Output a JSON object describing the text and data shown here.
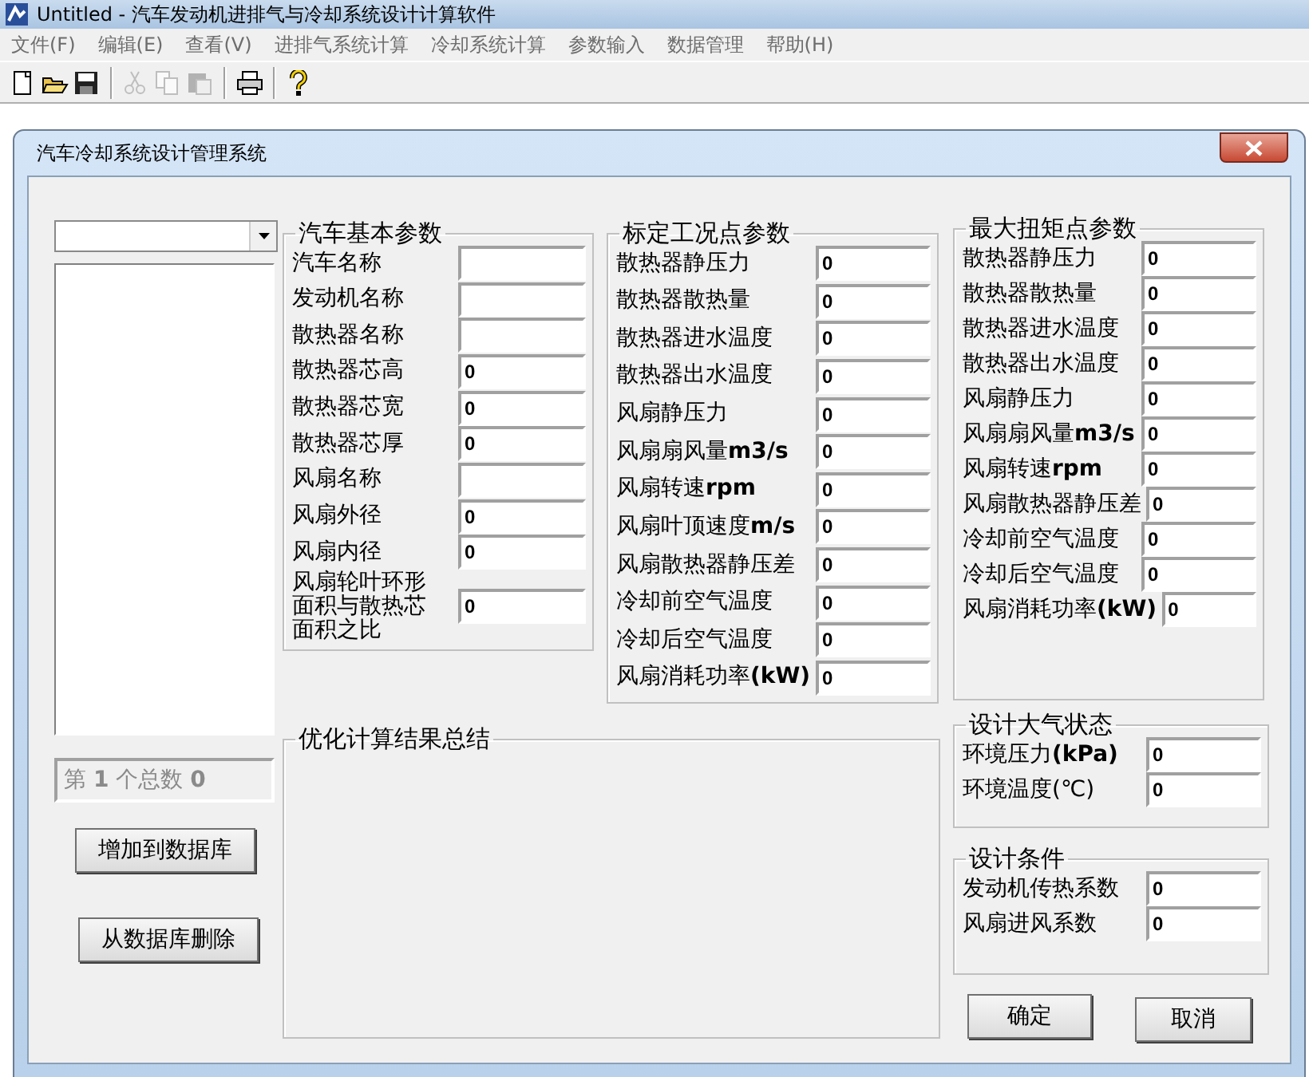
{
  "window": {
    "title": "Untitled - 汽车发动机进排气与冷却系统设计计算软件"
  },
  "menu": [
    "文件(F)",
    "编辑(E)",
    "查看(V)",
    "进排气系统计算",
    "冷却系统计算",
    "参数输入",
    "数据管理",
    "帮助(H)"
  ],
  "toolbar": [
    {
      "kind": "new",
      "disabled": false
    },
    {
      "kind": "open",
      "disabled": false
    },
    {
      "kind": "save",
      "disabled": false
    },
    {
      "kind": "separator"
    },
    {
      "kind": "cut",
      "disabled": true
    },
    {
      "kind": "copy",
      "disabled": true
    },
    {
      "kind": "paste",
      "disabled": true
    },
    {
      "kind": "separator"
    },
    {
      "kind": "print",
      "disabled": false
    },
    {
      "kind": "separator"
    },
    {
      "kind": "help",
      "disabled": false
    }
  ],
  "dialog": {
    "title": "汽车冷却系统设计管理系统",
    "record_status": {
      "text": "第 **1** 个总数 **0**",
      "disabled": true
    },
    "record_buttons": [
      "增加到数据库",
      "从数据库删除"
    ],
    "basic_params": {
      "title": "汽车基本参数",
      "fields": [
        {
          "label": "汽车名称"
        },
        {
          "label": "发动机名称"
        },
        {
          "label": "散热器名称"
        },
        {
          "label": "散热器芯高",
          "value": "0"
        },
        {
          "label": "散热器芯宽",
          "value": "0"
        },
        {
          "label": "散热器芯厚",
          "value": "0"
        },
        {
          "label": "风扇名称"
        },
        {
          "label": "风扇外径",
          "value": "0"
        },
        {
          "label": "风扇内径",
          "value": "0"
        },
        {
          "label": "风扇轮叶环形面积与散热芯面积之比",
          "value": "0"
        }
      ]
    },
    "rated_point": {
      "title": "标定工况点参数",
      "fields": [
        {
          "label": "散热器静压力",
          "value": "0"
        },
        {
          "label": "散热器散热量",
          "value": "0"
        },
        {
          "label": "散热器进水温度",
          "value": "0"
        },
        {
          "label": "散热器出水温度",
          "value": "0"
        },
        {
          "label": "风扇静压力",
          "value": "0"
        },
        {
          "label": "风扇扇风量**m3/s**",
          "value": "0"
        },
        {
          "label": "风扇转速**rpm**",
          "value": "0"
        },
        {
          "label": "风扇叶顶速度**m/s**",
          "value": "0"
        },
        {
          "label": "风扇散热器静压差",
          "value": "0"
        },
        {
          "label": "冷却前空气温度",
          "value": "0"
        },
        {
          "label": "冷却后空气温度",
          "value": "0"
        },
        {
          "label": "风扇消耗功率**(kW)**",
          "value": "0"
        }
      ]
    },
    "max_torque_point": {
      "title": "最大扭矩点参数",
      "fields": [
        {
          "label": "散热器静压力",
          "value": "0"
        },
        {
          "label": "散热器散热量",
          "value": "0"
        },
        {
          "label": "散热器进水温度",
          "value": "0"
        },
        {
          "label": "散热器出水温度",
          "value": "0"
        },
        {
          "label": "风扇静压力",
          "value": "0"
        },
        {
          "label": "风扇扇风量**m3/s**",
          "value": "0"
        },
        {
          "label": "风扇转速**rpm**",
          "value": "0"
        },
        {
          "label": "风扇散热器静压差",
          "value": "0"
        },
        {
          "label": "冷却前空气温度",
          "value": "0"
        },
        {
          "label": "冷却后空气温度",
          "value": "0"
        },
        {
          "label": "风扇消耗功率**(kW)**",
          "value": "0"
        }
      ]
    },
    "summary": {
      "title": "优化计算结果总结"
    },
    "design_atmosphere": {
      "title": "设计大气状态",
      "fields": [
        {
          "label": "环境压力**(kPa)**",
          "value": "0"
        },
        {
          "label": "环境温度(℃)",
          "value": "0"
        }
      ]
    },
    "design_conditions": {
      "title": "设计条件",
      "fields": [
        {
          "label": "发动机传热系数",
          "value": "0"
        },
        {
          "label": "风扇进风系数",
          "value": "0"
        }
      ]
    },
    "buttons": [
      "确定",
      "取消"
    ]
  }
}
